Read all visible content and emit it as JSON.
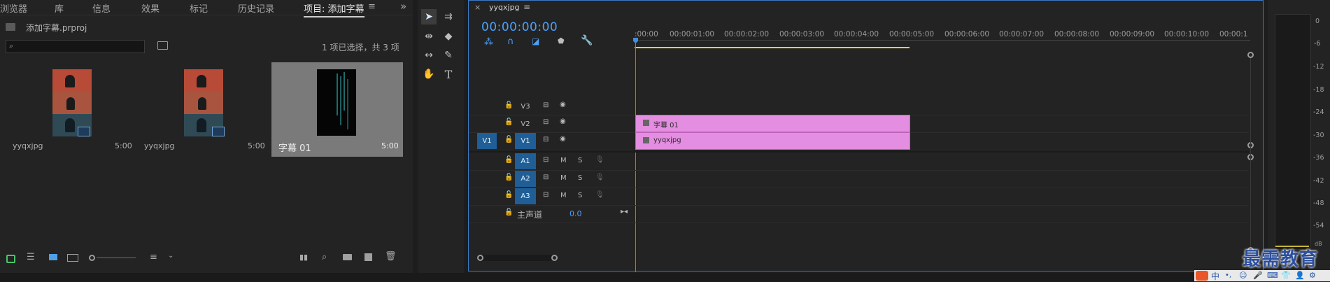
{
  "project_panel": {
    "tabs": [
      {
        "label": "浏览器"
      },
      {
        "label": "库"
      },
      {
        "label": "信息"
      },
      {
        "label": "效果"
      },
      {
        "label": "标记"
      },
      {
        "label": "历史记录"
      },
      {
        "label": "项目: 添加字幕"
      }
    ],
    "more_glyph": "»",
    "file_name": "添加字幕.prproj",
    "search_placeholder": "",
    "selection_status": "1 项已选择，共 3 项",
    "items": [
      {
        "name": "yyqxjpg",
        "duration": "5:00"
      },
      {
        "name": "yyqxjpg",
        "duration": "5:00"
      },
      {
        "name": "字幕 01",
        "duration": "5:00"
      }
    ]
  },
  "timeline": {
    "sequence_name": "yyqxjpg",
    "timecode": "00:00:00:00",
    "ruler": [
      ":00:00",
      "00:00:01:00",
      "00:00:02:00",
      "00:00:03:00",
      "00:00:04:00",
      "00:00:05:00",
      "00:00:06:00",
      "00:00:07:00",
      "00:00:08:00",
      "00:00:09:00",
      "00:00:10:00",
      "00:00:1"
    ],
    "video_tracks": [
      {
        "name": "V3",
        "source": ""
      },
      {
        "name": "V2",
        "source": ""
      },
      {
        "name": "V1",
        "source": "V1"
      }
    ],
    "audio_tracks": [
      {
        "name": "A1",
        "m": "M",
        "s": "S"
      },
      {
        "name": "A2",
        "m": "M",
        "s": "S"
      },
      {
        "name": "A3",
        "m": "M",
        "s": "S"
      }
    ],
    "master": {
      "label": "主声道",
      "value": "0.0"
    },
    "clips": [
      {
        "label": "字幕 01",
        "track": "V2"
      },
      {
        "label": "yyqxjpg",
        "track": "V1"
      }
    ],
    "clip_color": "#e38ee0",
    "accent": "#3d78c5"
  },
  "audio_meter": {
    "scale": [
      "0",
      "-6",
      "-12",
      "-18",
      "-24",
      "-30",
      "-36",
      "-42",
      "-48",
      "-54",
      "dB"
    ]
  },
  "watermark": "最需教育",
  "taskbar_glyph": "中"
}
